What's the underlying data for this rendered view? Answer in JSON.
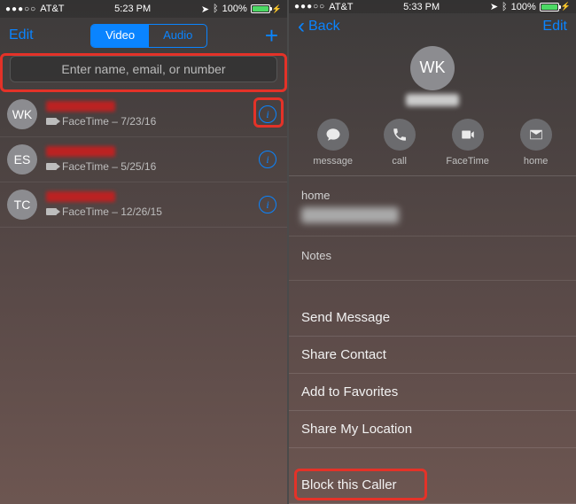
{
  "left": {
    "statusbar": {
      "carrier": "AT&T",
      "time": "5:23 PM",
      "battery": "100%"
    },
    "nav": {
      "edit": "Edit",
      "seg_video": "Video",
      "seg_audio": "Audio"
    },
    "search_placeholder": "Enter name, email, or number",
    "calls": [
      {
        "initials": "WK",
        "sub": "FaceTime – 7/23/16"
      },
      {
        "initials": "ES",
        "sub": "FaceTime – 5/25/16"
      },
      {
        "initials": "TC",
        "sub": "FaceTime – 12/26/15"
      }
    ]
  },
  "right": {
    "statusbar": {
      "carrier": "AT&T",
      "time": "5:33 PM",
      "battery": "100%"
    },
    "nav": {
      "back": "Back",
      "edit": "Edit",
      "initials": "WK"
    },
    "actions": [
      {
        "key": "message",
        "label": "message"
      },
      {
        "key": "call",
        "label": "call"
      },
      {
        "key": "facetime",
        "label": "FaceTime"
      },
      {
        "key": "home",
        "label": "home"
      }
    ],
    "fields": {
      "home_label": "home",
      "notes_label": "Notes"
    },
    "links": {
      "send_message": "Send Message",
      "share_contact": "Share Contact",
      "add_favorites": "Add to Favorites",
      "share_location": "Share My Location",
      "block": "Block this Caller"
    }
  }
}
